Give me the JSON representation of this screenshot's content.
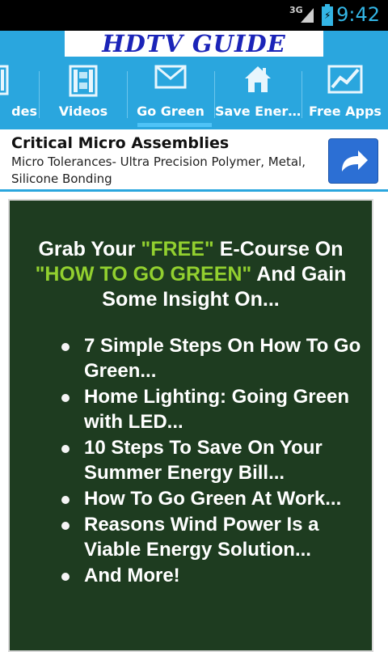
{
  "status_bar": {
    "network": "3G",
    "time": "9:42"
  },
  "header": {
    "title": "HDTV GUIDE"
  },
  "tabs": [
    {
      "label": "des",
      "icon": "film-strip-icon"
    },
    {
      "label": "Videos",
      "icon": "film-strip-icon"
    },
    {
      "label": "Go Green",
      "icon": "envelope-icon",
      "selected": true
    },
    {
      "label": "Save Ener…",
      "icon": "house-icon"
    },
    {
      "label": "Free Apps",
      "icon": "chart-icon"
    }
  ],
  "ad": {
    "title": "Critical Micro Assemblies",
    "description": "Micro Tolerances- Ultra Precision Polymer, Metal, Silicone Bonding",
    "button_icon": "share-arrow-icon"
  },
  "content": {
    "headline_part1": "Grab Your ",
    "headline_free": "\"FREE\"",
    "headline_part2": " E-Course On ",
    "headline_topic": "\"HOW TO GO GREEN\"",
    "headline_part3": " And Gain Some Insight On...",
    "bullets": [
      "7 Simple Steps On How To Go Green...",
      "Home Lighting: Going Green with LED...",
      "10 Steps To Save On Your Summer Energy Bill...",
      "How To Go Green At Work...",
      "Reasons Wind Power Is a Viable Energy Solution...",
      "And More!"
    ]
  },
  "colors": {
    "accent_blue": "#2aa6de",
    "panel_green": "#1e3c20",
    "highlight_green": "#92d02f",
    "title_blue": "#1b24b8"
  }
}
